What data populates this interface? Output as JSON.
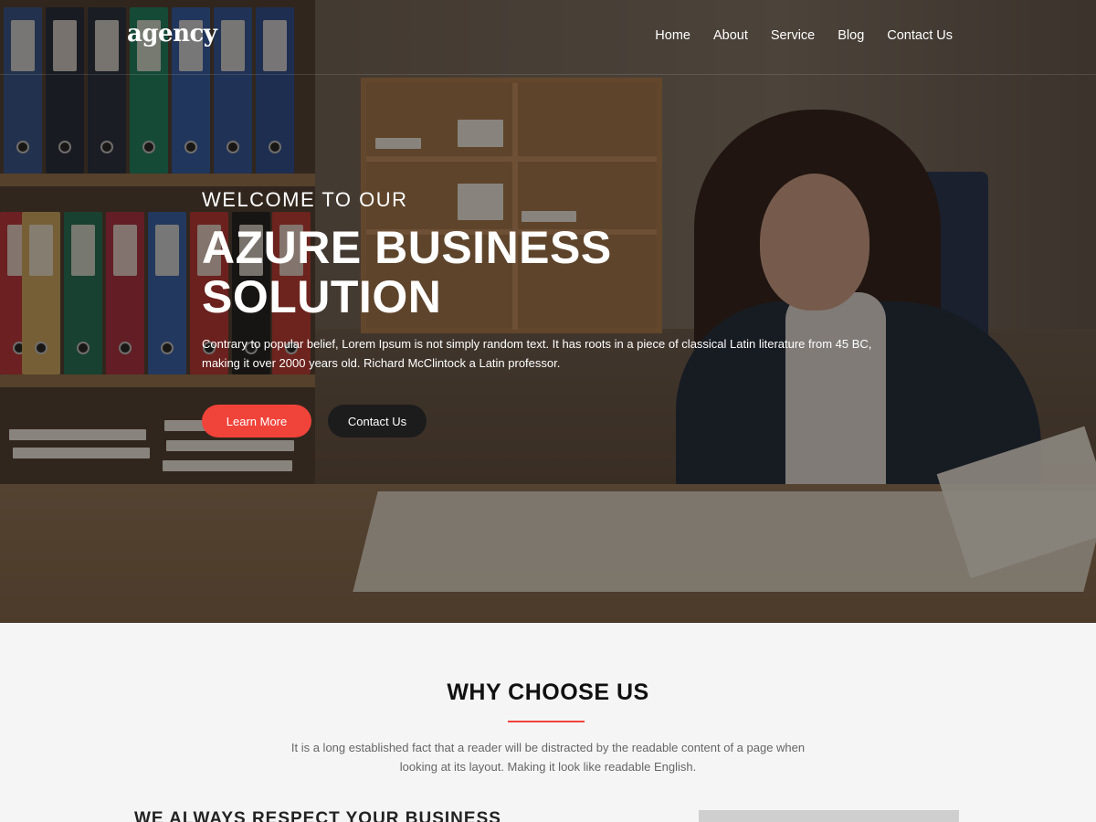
{
  "header": {
    "logo": "agency",
    "nav": [
      "Home",
      "About",
      "Service",
      "Blog",
      "Contact Us"
    ]
  },
  "hero": {
    "welcome": "WELCOME TO OUR",
    "headline_line1": "AZURE BUSINESS",
    "headline_line2": "SOLUTION",
    "intro": "Contrary to popular belief, Lorem Ipsum is not simply random text. It has roots in a piece of classical Latin literature from 45 BC, making it over 2000 years old. Richard McClintock  a Latin professor.",
    "learn_more": "Learn More",
    "contact_us": "Contact Us"
  },
  "why": {
    "title": "WHY CHOOSE US",
    "description": "It is a long established fact that a reader will be distracted by the readable content of a page when looking at its layout. Making it look like readable English.",
    "subheading": "WE ALWAYS RESPECT YOUR BUSINESS"
  },
  "colors": {
    "accent": "#f0433a",
    "dark_button": "#1c1c1c"
  }
}
